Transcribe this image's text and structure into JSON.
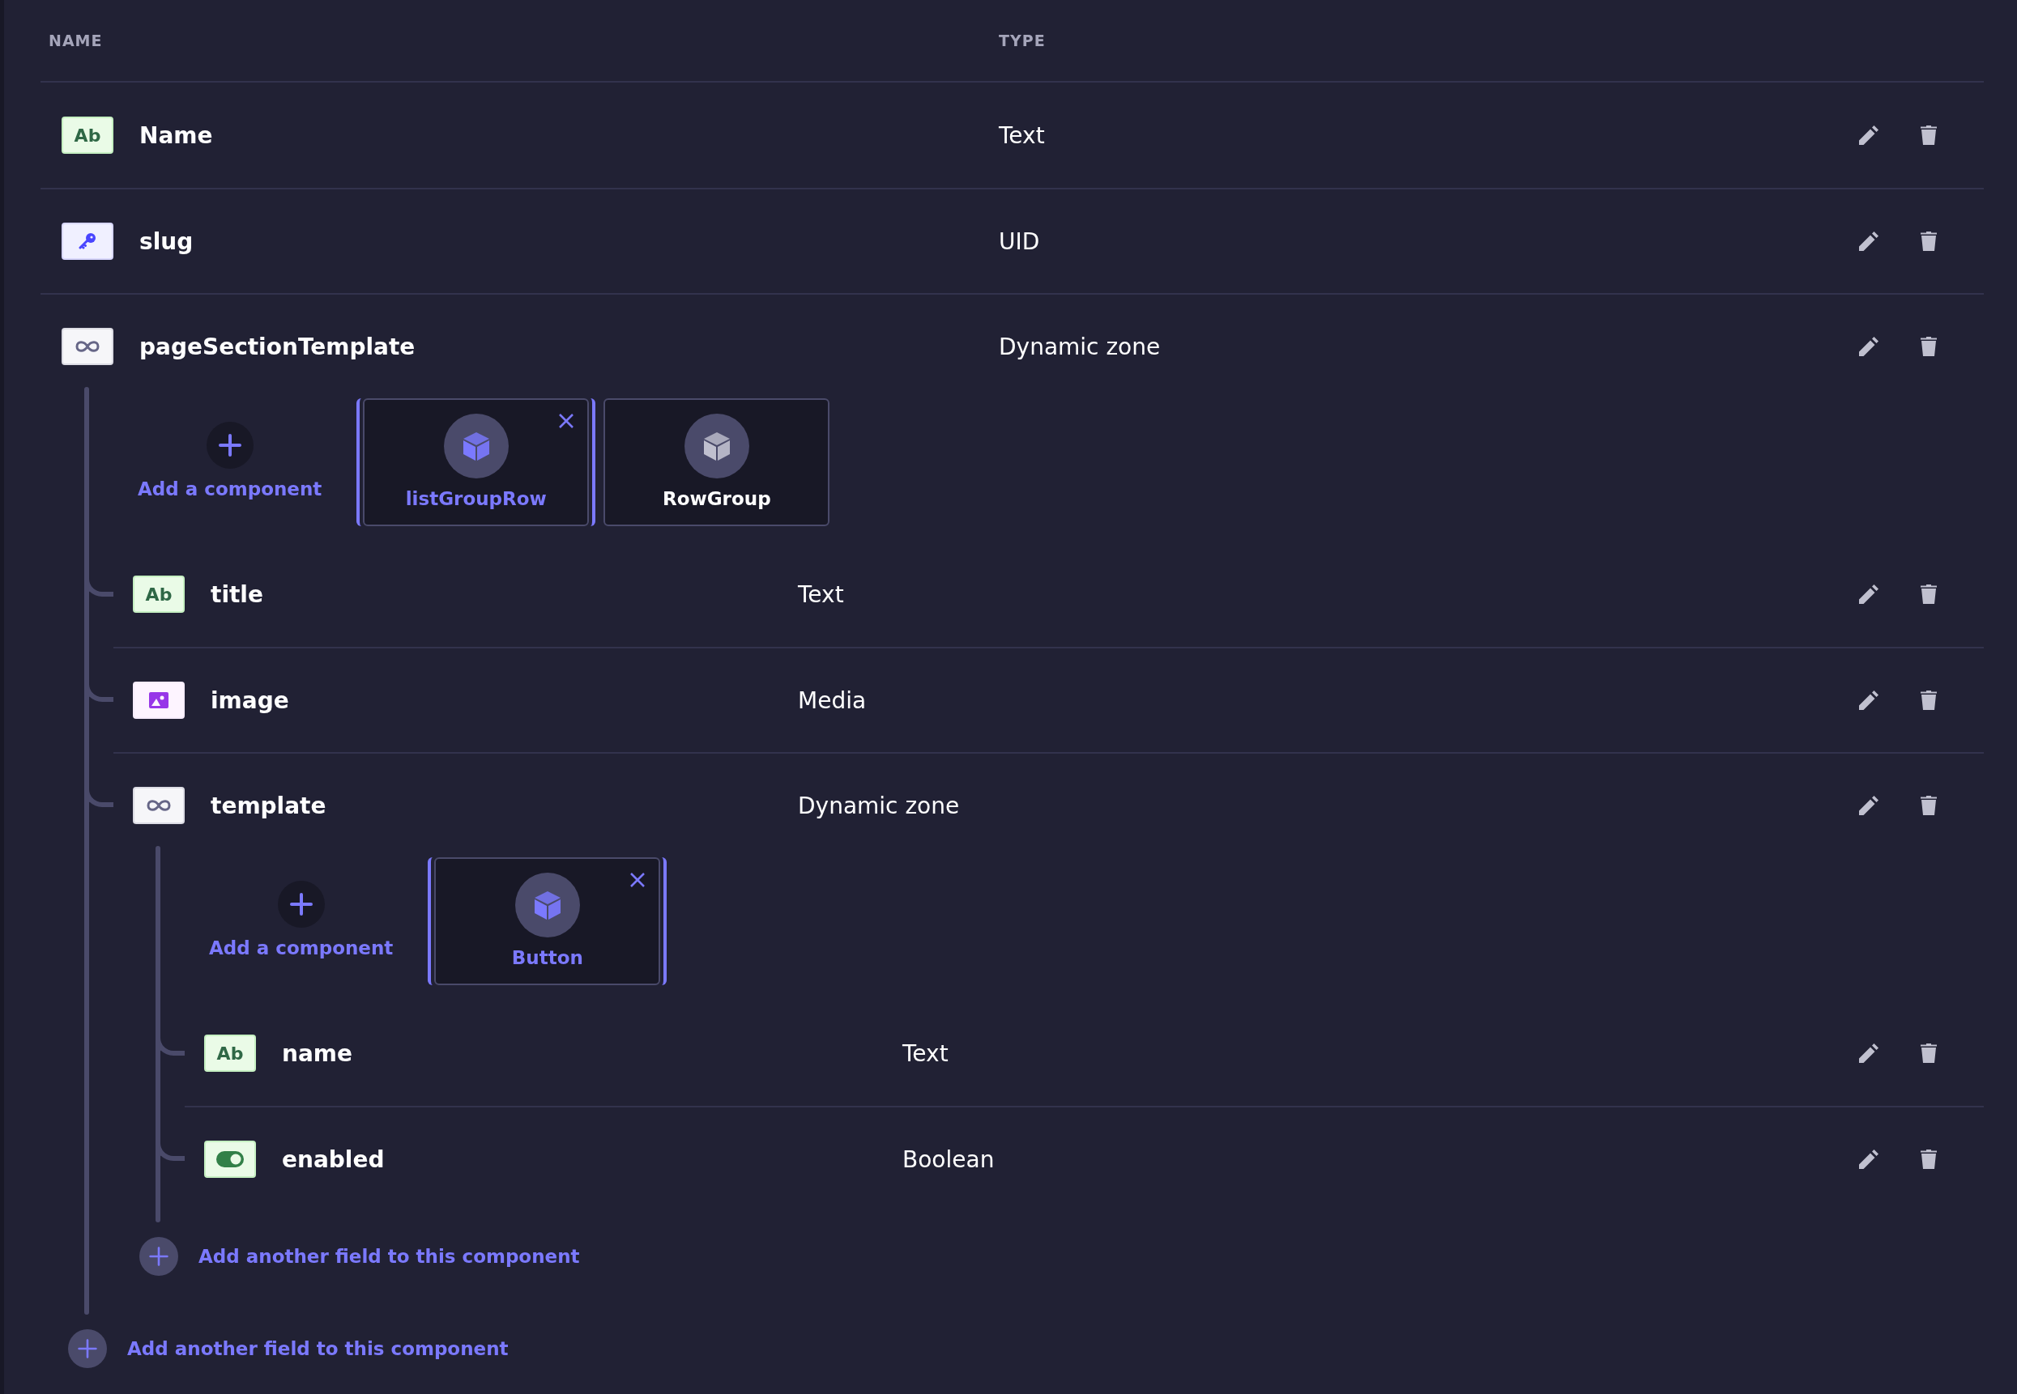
{
  "table": {
    "columns": [
      "NAME",
      "TYPE"
    ],
    "fields": [
      {
        "kind": "text",
        "icon_text": "Ab",
        "name": "Name",
        "type": "Text"
      },
      {
        "kind": "uid",
        "name": "slug",
        "type": "UID"
      },
      {
        "kind": "dynamic_zone",
        "name": "pageSectionTemplate",
        "type": "Dynamic zone",
        "add_component": "Add a component",
        "components": [
          {
            "name": "listGroupRow",
            "selected": true
          },
          {
            "name": "RowGroup",
            "selected": false
          }
        ],
        "fields": [
          {
            "kind": "text",
            "icon_text": "Ab",
            "name": "title",
            "type": "Text"
          },
          {
            "kind": "media",
            "name": "image",
            "type": "Media"
          },
          {
            "kind": "dynamic_zone",
            "name": "template",
            "type": "Dynamic zone",
            "add_component": "Add a component",
            "components": [
              {
                "name": "Button",
                "selected": true
              }
            ],
            "fields": [
              {
                "kind": "text",
                "icon_text": "Ab",
                "name": "name",
                "type": "Text"
              },
              {
                "kind": "boolean",
                "name": "enabled",
                "type": "Boolean"
              }
            ],
            "add_field": "Add another field to this component"
          }
        ],
        "add_field": "Add another field to this component"
      }
    ]
  }
}
